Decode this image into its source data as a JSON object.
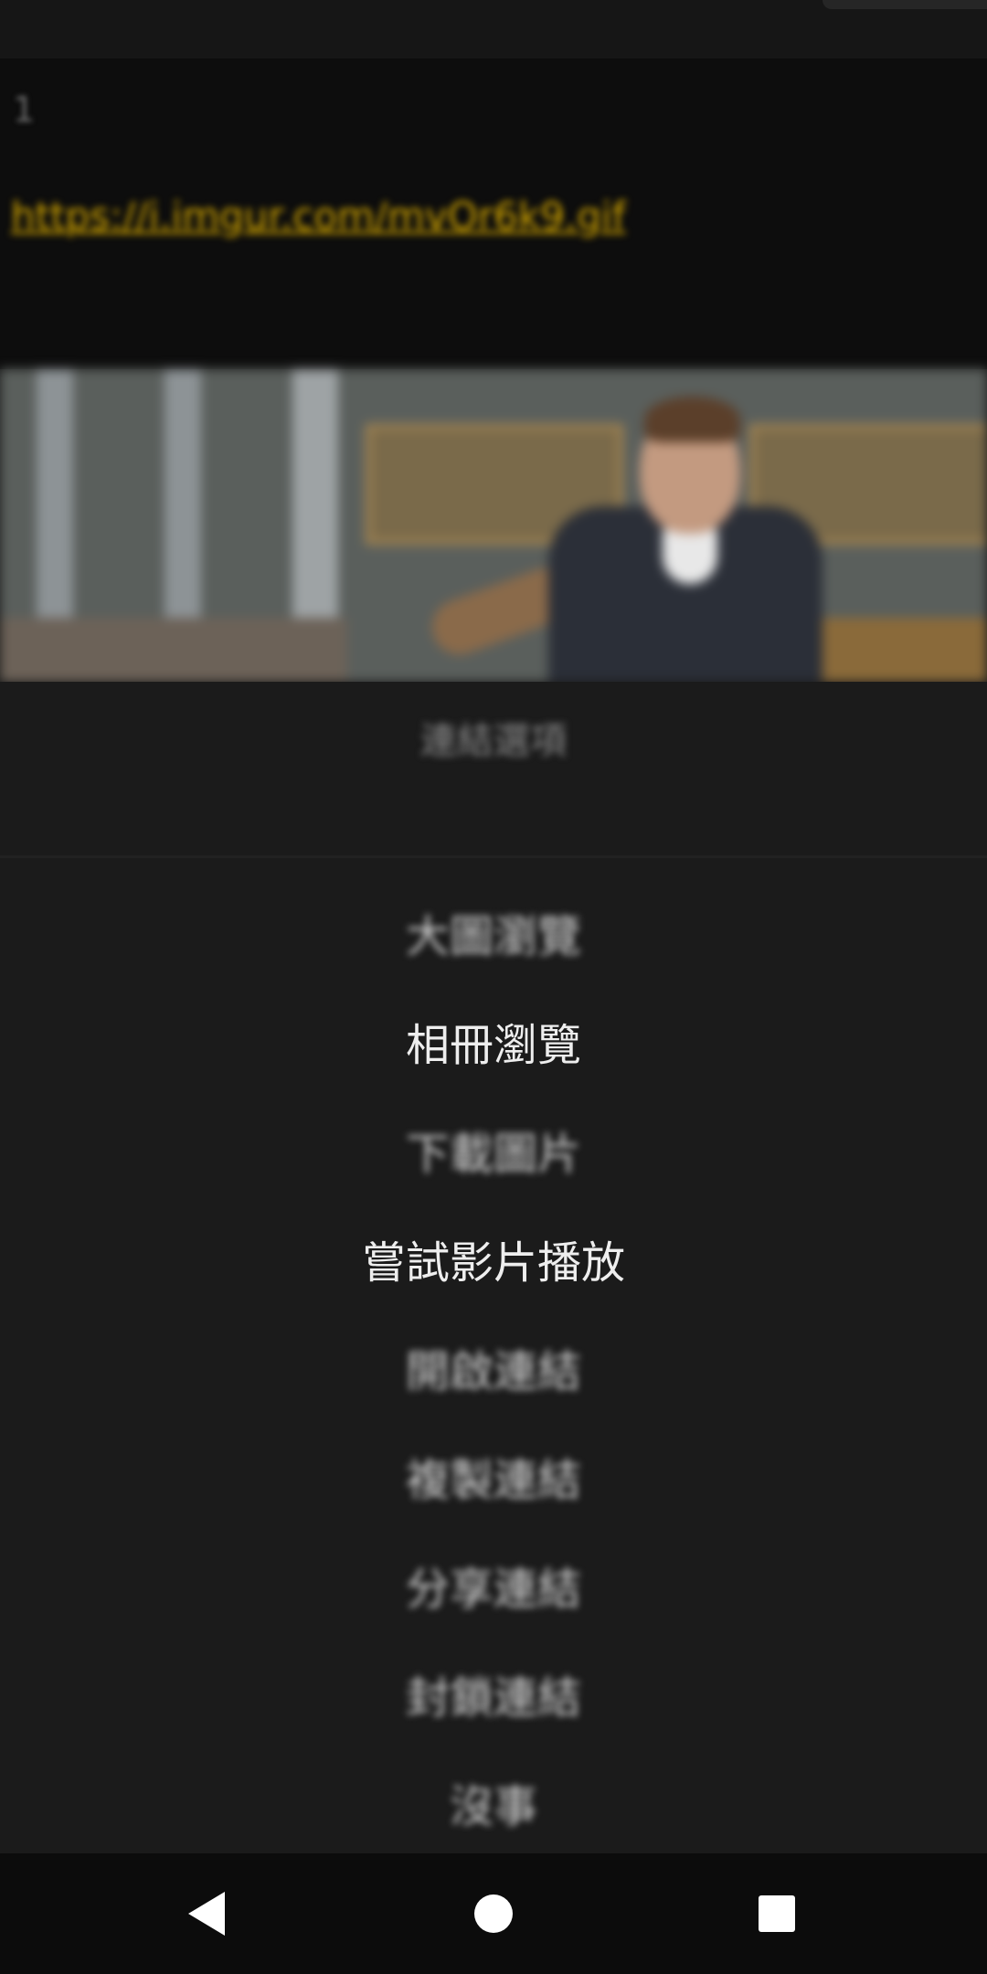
{
  "post": {
    "index": "1",
    "link": "https://i.imgur.com/mvOr6k9.gif"
  },
  "dialog": {
    "title": "連結選項",
    "items": [
      {
        "label": "大圖瀏覽"
      },
      {
        "label": "相冊瀏覽"
      },
      {
        "label": "下載圖片"
      },
      {
        "label": "嘗試影片播放"
      },
      {
        "label": "開啟連結"
      },
      {
        "label": "複製連結"
      },
      {
        "label": "分享連結"
      },
      {
        "label": "封鎖連結"
      },
      {
        "label": "沒事"
      }
    ]
  },
  "nav": {
    "back_icon": "back-triangle",
    "home_icon": "home-circle",
    "recents_icon": "recents-square"
  },
  "colors": {
    "background": "#1b1b1b",
    "link": "#d5a800",
    "menu_text": "#eeeeee",
    "nav_bar": "#0c0c0c"
  }
}
